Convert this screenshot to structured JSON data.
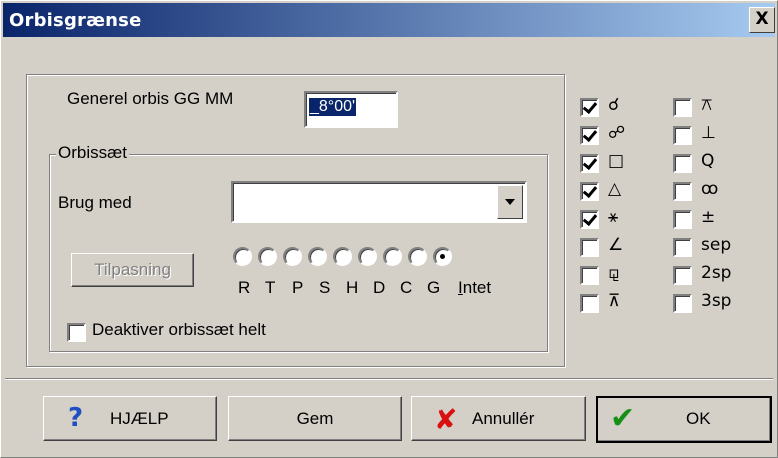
{
  "window": {
    "title": "Orbisgrænse",
    "close": "X"
  },
  "general": {
    "label": "Generel orbis GG MM",
    "value": "_8°00'"
  },
  "orbisset": {
    "group_label": "Orbissæt",
    "brug_med_label": "Brug med",
    "brug_med_value": "",
    "tilpasning_label": "Tilpasning",
    "radio_letters": [
      "R",
      "T",
      "P",
      "S",
      "H",
      "D",
      "C",
      "G"
    ],
    "intet_label": "Intet",
    "selected_radio": "Intet",
    "deaktiver_label": "Deaktiver orbissæt helt",
    "deaktiver_checked": false
  },
  "aspects_left": [
    {
      "symbol": "☌",
      "checked": true
    },
    {
      "symbol": "☍",
      "checked": true
    },
    {
      "symbol": "□",
      "checked": true
    },
    {
      "symbol": "△",
      "checked": true
    },
    {
      "symbol": "⚹",
      "checked": true
    },
    {
      "symbol": "∠",
      "checked": false
    },
    {
      "symbol": "⚼",
      "checked": false
    },
    {
      "symbol": "⊼",
      "checked": false
    }
  ],
  "aspects_right": [
    {
      "symbol": "⚻",
      "checked": false
    },
    {
      "symbol": "⊥",
      "checked": false
    },
    {
      "symbol": "Q",
      "checked": false
    },
    {
      "symbol": "ꝏ",
      "checked": false
    },
    {
      "symbol": "±",
      "checked": false
    },
    {
      "symbol": "sep",
      "checked": false
    },
    {
      "symbol": "2sp",
      "checked": false
    },
    {
      "symbol": "3sp",
      "checked": false
    }
  ],
  "buttons": {
    "help": "HJÆLP",
    "save": "Gem",
    "cancel": "Annullér",
    "ok": "OK"
  },
  "colors": {
    "title_bar_start": "#0a246a",
    "title_bar_end": "#a6caf0",
    "help_icon": "#1f4fc0",
    "cancel_icon": "#d81010",
    "ok_icon": "#159015"
  }
}
